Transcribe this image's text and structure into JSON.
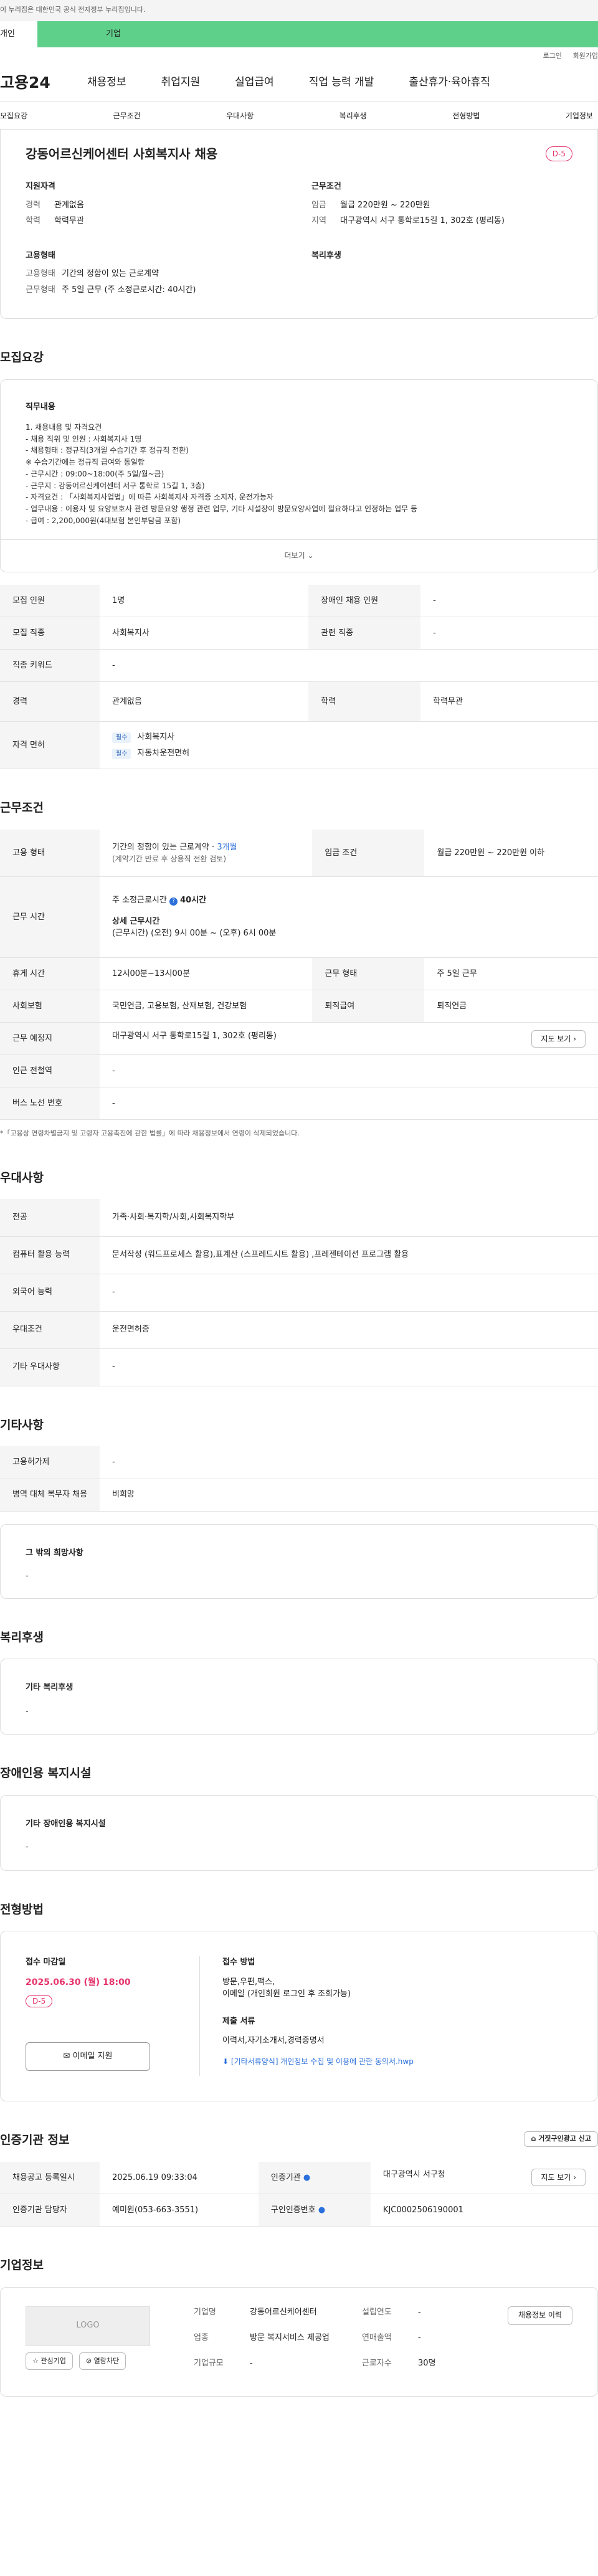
{
  "gov_banner": "이 누리집은 대한민국 공식 전자정부 누리집입니다.",
  "type_tabs": {
    "personal": "개인",
    "business": "기업"
  },
  "util": {
    "login": "로그인",
    "join": "회원가입"
  },
  "gnb": {
    "logo": "고용24",
    "items": [
      "채용정보",
      "취업지원",
      "실업급여",
      "직업 능력 개발",
      "출산휴가·육아휴직"
    ]
  },
  "subnav": [
    "모집요강",
    "근무조건",
    "우대사항",
    "복리후생",
    "전형방법",
    "기업정보"
  ],
  "summary": {
    "title": "강동어르신케어센터 사회복지사 채용",
    "badge": "D-5",
    "qualification": {
      "heading": "지원자격",
      "career_k": "경력",
      "career_v": "관계없음",
      "edu_k": "학력",
      "edu_v": "학력무관"
    },
    "conditions": {
      "heading": "근무조건",
      "wage_k": "임금",
      "wage_v": "월급 220만원 ~ 220만원",
      "area_k": "지역",
      "area_v": "대구광역시 서구 통학로15길 1, 302호 (평리동)"
    },
    "employment": {
      "heading": "고용형태",
      "type_k": "고용형태",
      "type_v": "기간의 정함이 있는 근로계약",
      "form_k": "근무형태",
      "form_v": "주 5일 근무 (주 소정근로시간: 40시간)"
    },
    "welfare": {
      "heading": "복리후생"
    }
  },
  "recruit": {
    "heading": "모집요강",
    "duty_heading": "직무내용",
    "duty_lines": [
      "1. 채용내용 및 자격요건",
      "  - 채용 직위 및 인원 : 사회복지사 1명",
      "  - 채용형태 : 정규직(3개월 수습기간 후 정규직 전환)",
      "      ※ 수습기간에는 정규직 급여와 동일함",
      "  - 근무시간 : 09:00~18:00(주 5일/월~금)",
      "  - 근무지 : 강동어르신케어센터 서구 통학로 15길 1, 3층)",
      "  - 자격요건 : 「사회복지사업법」에 따른 사회복지사 자격증 소지자, 운전가능자",
      "  - 업무내용 : 이용자 및 요양보호사 관련 방문요양 행정 관련 업무, 기타 시설장이 방문요양사업에 필요하다고 인정하는 업무 등",
      "  - 급여 : 2,200,000원(4대보험 본인부담금 포함)"
    ],
    "more": "더보기",
    "rows": {
      "count_k": "모집 인원",
      "count_v": "1명",
      "disabled_k": "장애인 채용 인원",
      "disabled_v": "-",
      "job_k": "모집 직종",
      "job_v": "사회복지사",
      "related_k": "관련 직종",
      "related_v": "-",
      "keyword_k": "직종 키워드",
      "keyword_v": "-",
      "career_k": "경력",
      "career_v": "관계없음",
      "edu_k": "학력",
      "edu_v": "학력무관",
      "license_k": "자격 면허",
      "license_tag": "필수",
      "license_1": "사회복지사",
      "license_2": "자동차운전면허"
    }
  },
  "work": {
    "heading": "근무조건",
    "type_k": "고용 형태",
    "type_v1": "기간의 정함이 있는 근로계약 · ",
    "type_v1b": "3개월",
    "type_v2": "(계약기간 만료 후 상용직 전환 검토)",
    "wage_k": "임금 조건",
    "wage_v": "월급 220만원 ~ 220만원 이하",
    "hours_k": "근무 시간",
    "hours_total": "주 소정근로시간 ",
    "hours_total_v": "40시간",
    "hours_detail_h": "상세 근무시간",
    "hours_detail_v": "(근무시간) (오전) 9시 00분 ~ (오후) 6시 00분",
    "break_k": "휴게 시간",
    "break_v": "12시00분~13시00분",
    "form_k": "근무 형태",
    "form_v": "주 5일 근무",
    "insurance_k": "사회보험",
    "insurance_v": "국민연금, 고용보험, 산재보험, 건강보험",
    "severance_k": "퇴직급여",
    "severance_v": "퇴직연금",
    "place_k": "근무 예정지",
    "place_v": "대구광역시 서구 통학로15길 1, 302호 (평리동)",
    "map_btn": "지도 보기",
    "subway_k": "인근 전철역",
    "subway_v": "-",
    "bus_k": "버스 노선 번호",
    "bus_v": "-",
    "note": "*「고용상 연령차별금지 및 고령자 고용촉진에 관한 법률」에 따라 채용정보에서 연령이 삭제되었습니다."
  },
  "pref": {
    "heading": "우대사항",
    "major_k": "전공",
    "major_v": "가족·사회·복지학/사회,사회복지학부",
    "computer_k": "컴퓨터 활용 능력",
    "computer_v": "문서작성 (워드프로세스 활용),표계산 (스프레드시트 활용) ,프레젠테이션 프로그램 활용",
    "lang_k": "외국어 능력",
    "lang_v": "-",
    "cond_k": "우대조건",
    "cond_v": "운전면허증",
    "etc_k": "기타 우대사항",
    "etc_v": "-"
  },
  "etc": {
    "heading": "기타사항",
    "emp_k": "고용허가제",
    "emp_v": "-",
    "mil_k": "병역 대체 복무자 채용",
    "mil_v": "비희망",
    "wish_h": "그 밖의 희망사항",
    "wish_v": "-"
  },
  "welfare": {
    "heading": "복리후생",
    "box_h": "기타 복리후생",
    "box_v": "-"
  },
  "facility": {
    "heading": "장애인용 복지시설",
    "box_h": "기타 장애인용 복지시설",
    "box_v": "-"
  },
  "method": {
    "heading": "전형방법",
    "deadline_h": "접수 마감일",
    "deadline_v": "2025.06.30 (월) 18:00",
    "badge": "D-5",
    "email_btn": "이메일 지원",
    "method_h": "접수 방법",
    "method_v1": "방문,우편,팩스,",
    "method_v2": "이메일 (개인회원 로그인 후 조회가능)",
    "docs_h": "제출 서류",
    "docs_v": "이력서,자기소개서,경력증명서",
    "docs_link": "[기타서류양식] 개인정보 수집 및 이용에 관한 동의서.hwp"
  },
  "cert": {
    "heading": "인증기관 정보",
    "report_btn": "거짓구인광고 신고",
    "reg_k": "채용공고 등록일시",
    "reg_v": "2025.06.19 09:33:04",
    "org_k": "인증기관",
    "org_v": "대구광역시 서구청",
    "map_btn": "지도 보기",
    "manager_k": "인증기관 담당자",
    "manager_v": "예미원(053-663-3551)",
    "no_k": "구인인증번호",
    "no_v": "KJC0002506190001"
  },
  "company": {
    "heading": "기업정보",
    "logo": "LOGO",
    "fav_btn": "관심기업",
    "block_btn": "열람차단",
    "name_k": "기업명",
    "name_v": "강동어르신케어센터",
    "year_k": "설립연도",
    "year_v": "-",
    "biz_k": "업종",
    "biz_v": "방문 복지서비스 제공업",
    "sales_k": "연매출액",
    "sales_v": "-",
    "emp_k": "근로자수",
    "emp_v": "30명",
    "size_k": "기업규모",
    "size_v": "-",
    "link_btn": "채용정보 이력"
  },
  "colors": {
    "accent_pink": "#e5336b",
    "business_green": "#5fd08a",
    "link_blue": "#2a6fdb"
  }
}
